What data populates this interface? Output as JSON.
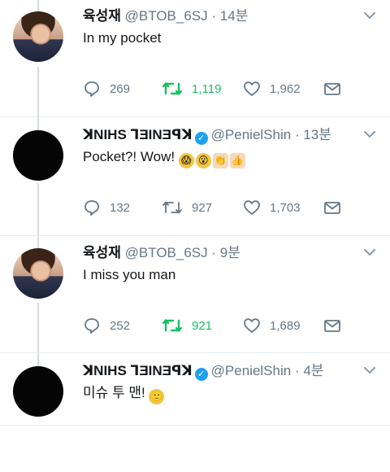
{
  "tweets": [
    {
      "name": "육성재",
      "handle": "@BTOB_6SJ",
      "dot": "·",
      "time": "14분",
      "text": "In my pocket",
      "verified": false,
      "avatar": "photo",
      "retweeted": true,
      "counts": {
        "reply": "269",
        "retweet": "1,119",
        "like": "1,962"
      }
    },
    {
      "name": "ꓘNIHS ꞀƎINƎꟼꓘ",
      "handle": "@PenielShin",
      "dot": "·",
      "time": "13분",
      "text": "Pocket?! Wow! ",
      "verified": true,
      "avatar": "dark",
      "retweeted": false,
      "emojis": [
        "😱",
        "😮",
        "👏",
        "👍"
      ],
      "counts": {
        "reply": "132",
        "retweet": "927",
        "like": "1,703"
      }
    },
    {
      "name": "육성재",
      "handle": "@BTOB_6SJ",
      "dot": "·",
      "time": "9분",
      "text": "I miss you man",
      "verified": false,
      "avatar": "photo",
      "retweeted": true,
      "counts": {
        "reply": "252",
        "retweet": "921",
        "like": "1,689"
      }
    },
    {
      "name": "ꓘNIHS ꞀƎINƎꟼꓘ",
      "handle": "@PenielShin",
      "dot": "·",
      "time": "4분",
      "text": "미슈 투 맨! ",
      "verified": true,
      "avatar": "dark",
      "retweeted": false,
      "emojis": [
        "🙂"
      ],
      "counts": null
    }
  ],
  "icons": {
    "reply": "reply-icon",
    "retweet": "retweet-icon",
    "like": "heart-icon",
    "share": "envelope-icon",
    "menu": "chevron-down-icon",
    "verified": "verified-badge-icon"
  },
  "colors": {
    "text": "#14171a",
    "muted": "#657786",
    "retweet_active": "#17bf63",
    "verified": "#1da1f2",
    "thread_line": "#d6dce1"
  }
}
